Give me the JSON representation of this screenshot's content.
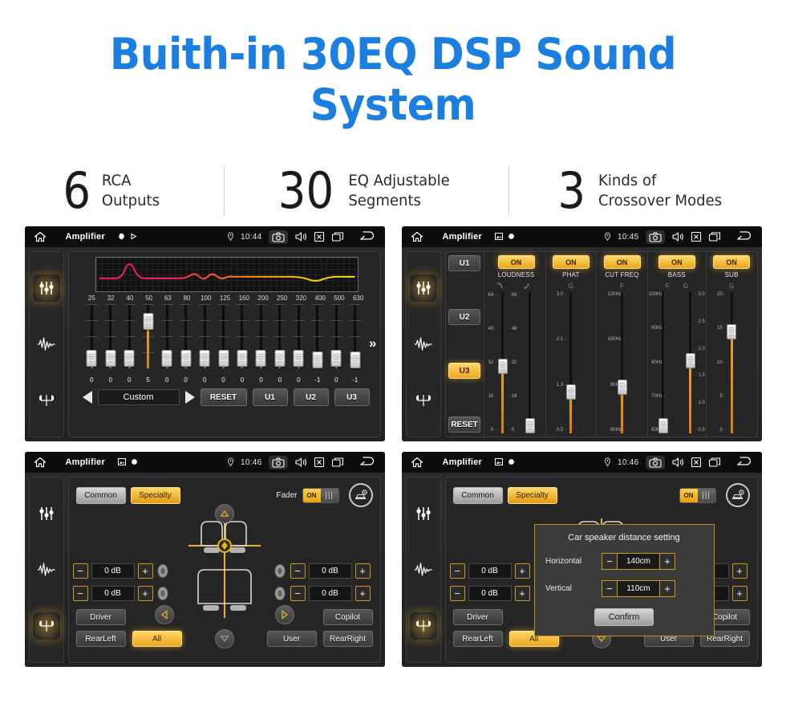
{
  "hero": {
    "title": "Buith-in 30EQ DSP Sound System",
    "accent_color": "#1a7fe0"
  },
  "stats": [
    {
      "number": "6",
      "text": "RCA\nOutputs"
    },
    {
      "number": "30",
      "text": "EQ Adjustable\nSegments"
    },
    {
      "number": "3",
      "text": "Kinds of\nCrossover Modes"
    }
  ],
  "panels": {
    "eq": {
      "statusbar": {
        "title": "Amplifier",
        "time": "10:44",
        "icons": [
          "home-icon",
          "record-icon",
          "play-icon",
          "location-icon",
          "camera-icon",
          "volume-icon",
          "close-box-icon",
          "recents-icon",
          "back-icon"
        ]
      },
      "sidebar": [
        {
          "icon": "equalizer-icon",
          "active": true
        },
        {
          "icon": "waveform-icon",
          "active": false
        },
        {
          "icon": "balance-icon",
          "active": false
        }
      ],
      "frequencies": [
        "25",
        "32",
        "40",
        "50",
        "63",
        "80",
        "100",
        "125",
        "160",
        "200",
        "250",
        "320",
        "400",
        "500",
        "630"
      ],
      "values": [
        "0",
        "0",
        "0",
        "5",
        "0",
        "0",
        "0",
        "0",
        "0",
        "0",
        "0",
        "0",
        "-1",
        "0",
        "-1"
      ],
      "preset": "Custom",
      "reset_label": "RESET",
      "user_presets": [
        "U1",
        "U2",
        "U3"
      ],
      "more_icon": "chevron-double-right-icon",
      "prev_icon": "triangle-left-icon",
      "next_icon": "triangle-right-icon"
    },
    "dsp": {
      "statusbar": {
        "title": "Amplifier",
        "time": "10:45"
      },
      "sidebar": [
        {
          "icon": "equalizer-icon",
          "active": true
        },
        {
          "icon": "waveform-icon",
          "active": false
        },
        {
          "icon": "balance-icon",
          "active": false
        }
      ],
      "preset_column": {
        "buttons": [
          "U1",
          "U2",
          "U3"
        ],
        "active": "U3",
        "reset_label": "RESET"
      },
      "bands": [
        {
          "name": "LOUDNESS",
          "state": "ON",
          "sub": [
            "curve-down-icon",
            "curve-up-icon"
          ],
          "sliders": [
            {
              "scale": [
                "64",
                "48",
                "32",
                "16",
                "0"
              ],
              "position": 0.48
            },
            {
              "scale": [
                "64",
                "48",
                "32",
                "16",
                "0"
              ],
              "position": 0.06
            }
          ]
        },
        {
          "name": "PHAT",
          "state": "ON",
          "sub": [
            "G"
          ],
          "sliders": [
            {
              "scale": [
                "3.0",
                "2.1",
                "1.3",
                "0.5"
              ],
              "position": 0.3
            }
          ]
        },
        {
          "name": "CUT FREQ",
          "state": "ON",
          "sub": [
            "F"
          ],
          "sliders": [
            {
              "scale": [
                "120Hz",
                "100Hz",
                "80Hz",
                "60Hz"
              ],
              "position": 0.33
            }
          ]
        },
        {
          "name": "BASS",
          "state": "ON",
          "sub": [
            "F",
            "G"
          ],
          "sliders": [
            {
              "scale": [
                "100Hz",
                "90Hz",
                "80Hz",
                "70Hz",
                "60Hz"
              ],
              "position": 0.06
            },
            {
              "scale": [
                "3.0",
                "2.5",
                "2.0",
                "1.5",
                "1.0",
                "0.5"
              ],
              "position": 0.52
            }
          ]
        },
        {
          "name": "SUB",
          "state": "ON",
          "sub": [
            "G"
          ],
          "sliders": [
            {
              "scale": [
                "20",
                "15",
                "10",
                "5",
                "0"
              ],
              "position": 0.72
            }
          ]
        }
      ]
    },
    "fader": {
      "statusbar": {
        "title": "Amplifier",
        "time": "10:46"
      },
      "sidebar": [
        {
          "icon": "equalizer-icon",
          "active": false
        },
        {
          "icon": "waveform-icon",
          "active": false
        },
        {
          "icon": "balance-icon",
          "active": true
        }
      ],
      "tabs": [
        {
          "label": "Common",
          "selected": false
        },
        {
          "label": "Specialty",
          "selected": true
        }
      ],
      "fader_label": "Fader",
      "fader_state": "ON",
      "car_settings_icon": "car-settings-icon",
      "steppers": [
        {
          "name": "front-left",
          "value": "0 dB"
        },
        {
          "name": "rear-left",
          "value": "0 dB"
        },
        {
          "name": "front-right",
          "value": "0 dB"
        },
        {
          "name": "rear-right",
          "value": "0 dB"
        }
      ],
      "minus_label": "−",
      "plus_label": "+",
      "position_buttons": [
        {
          "label": "Driver",
          "active": false
        },
        {
          "label": "RearLeft",
          "active": false
        },
        {
          "label": "All",
          "active": true
        },
        {
          "label": "User",
          "active": false
        },
        {
          "label": "Copilot",
          "active": false
        },
        {
          "label": "RearRight",
          "active": false
        }
      ]
    },
    "dialog_panel": {
      "statusbar": {
        "title": "Amplifier",
        "time": "10:46"
      },
      "modal": {
        "title": "Car speaker distance setting",
        "rows": [
          {
            "label": "Horizontal",
            "value": "140cm"
          },
          {
            "label": "Vertical",
            "value": "110cm"
          }
        ],
        "minus_label": "−",
        "plus_label": "+",
        "confirm_label": "Confirm"
      }
    }
  }
}
